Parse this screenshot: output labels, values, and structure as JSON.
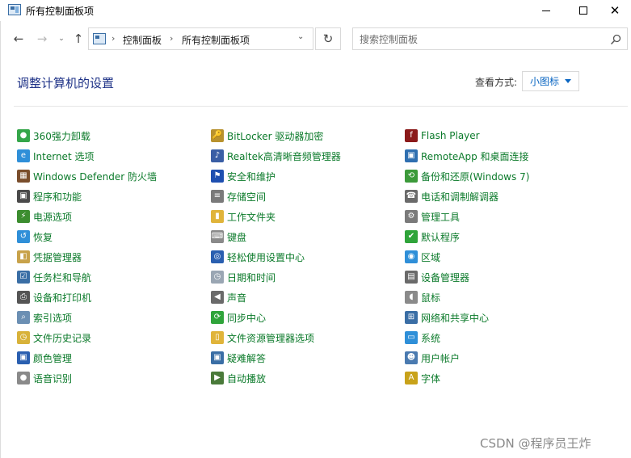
{
  "window": {
    "title": "所有控制面板项",
    "minimize_icon": "minimize-icon",
    "maximize_icon": "maximize-icon",
    "close_icon": "close-icon",
    "close_glyph": "✕"
  },
  "nav": {
    "back_glyph": "←",
    "forward_glyph": "→",
    "recent_glyph": "⌄",
    "up_glyph": "↑",
    "refresh_glyph": "↻",
    "breadcrumb": [
      "控制面板",
      "所有控制面板项"
    ],
    "breadcrumb_sep": "›",
    "dropdown_glyph": "⌄"
  },
  "search": {
    "placeholder": "搜索控制面板"
  },
  "main": {
    "heading": "调整计算机的设置",
    "view_by_label": "查看方式:",
    "view_by_value": "小图标"
  },
  "colors": {
    "link": "#0b7a2a",
    "heading": "#1e3287",
    "accent": "#0a66c2"
  },
  "items": {
    "col1": [
      {
        "label": "360强力卸载",
        "icon": "uninstall-icon",
        "color": "#35a64a",
        "glyph": "●"
      },
      {
        "label": "Internet 选项",
        "icon": "internet-options-icon",
        "color": "#2f8fd8",
        "glyph": "e"
      },
      {
        "label": "Windows Defender 防火墙",
        "icon": "firewall-icon",
        "color": "#7a4e2c",
        "glyph": "▦"
      },
      {
        "label": "程序和功能",
        "icon": "programs-icon",
        "color": "#4a4a4a",
        "glyph": "▣"
      },
      {
        "label": "电源选项",
        "icon": "power-options-icon",
        "color": "#3c8d2f",
        "glyph": "⚡"
      },
      {
        "label": "恢复",
        "icon": "recovery-icon",
        "color": "#2f8fd8",
        "glyph": "↺"
      },
      {
        "label": "凭据管理器",
        "icon": "credential-manager-icon",
        "color": "#c8a24a",
        "glyph": "◧"
      },
      {
        "label": "任务栏和导航",
        "icon": "taskbar-icon",
        "color": "#3a6ea5",
        "glyph": "☑"
      },
      {
        "label": "设备和打印机",
        "icon": "devices-printers-icon",
        "color": "#555555",
        "glyph": "⎙"
      },
      {
        "label": "索引选项",
        "icon": "indexing-icon",
        "color": "#6b8fb3",
        "glyph": "⌕"
      },
      {
        "label": "文件历史记录",
        "icon": "file-history-icon",
        "color": "#d8b23a",
        "glyph": "◷"
      },
      {
        "label": "颜色管理",
        "icon": "color-management-icon",
        "color": "#2a5fb0",
        "glyph": "▣"
      },
      {
        "label": "语音识别",
        "icon": "speech-recognition-icon",
        "color": "#8a8a8a",
        "glyph": "●"
      }
    ],
    "col2": [
      {
        "label": "BitLocker 驱动器加密",
        "icon": "bitlocker-icon",
        "color": "#b8922e",
        "glyph": "🔑"
      },
      {
        "label": "Realtek高清晰音频管理器",
        "icon": "audio-manager-icon",
        "color": "#3a5ea5",
        "glyph": "♪"
      },
      {
        "label": "安全和维护",
        "icon": "security-maintenance-icon",
        "color": "#1e4fb0",
        "glyph": "⚑"
      },
      {
        "label": "存储空间",
        "icon": "storage-spaces-icon",
        "color": "#7a7a7a",
        "glyph": "≡"
      },
      {
        "label": "工作文件夹",
        "icon": "work-folders-icon",
        "color": "#e0b43a",
        "glyph": "▮"
      },
      {
        "label": "键盘",
        "icon": "keyboard-icon",
        "color": "#8a8a8a",
        "glyph": "⌨"
      },
      {
        "label": "轻松使用设置中心",
        "icon": "ease-of-access-icon",
        "color": "#2a5fb0",
        "glyph": "◎"
      },
      {
        "label": "日期和时间",
        "icon": "date-time-icon",
        "color": "#9aa6b3",
        "glyph": "◷"
      },
      {
        "label": "声音",
        "icon": "sound-icon",
        "color": "#6a6a6a",
        "glyph": "◀"
      },
      {
        "label": "同步中心",
        "icon": "sync-center-icon",
        "color": "#2fa43a",
        "glyph": "⟳"
      },
      {
        "label": "文件资源管理器选项",
        "icon": "explorer-options-icon",
        "color": "#e0b43a",
        "glyph": "▯"
      },
      {
        "label": "疑难解答",
        "icon": "troubleshooting-icon",
        "color": "#3a6ea5",
        "glyph": "▣"
      },
      {
        "label": "自动播放",
        "icon": "autoplay-icon",
        "color": "#4a7a3a",
        "glyph": "▶"
      }
    ],
    "col3": [
      {
        "label": "Flash Player",
        "icon": "flash-player-icon",
        "color": "#8b1a1a",
        "glyph": "f"
      },
      {
        "label": "RemoteApp 和桌面连接",
        "icon": "remoteapp-icon",
        "color": "#2f6fb0",
        "glyph": "▣"
      },
      {
        "label": "备份和还原(Windows 7)",
        "icon": "backup-restore-icon",
        "color": "#3c9a3a",
        "glyph": "⟲"
      },
      {
        "label": "电话和调制解调器",
        "icon": "phone-modem-icon",
        "color": "#6a6a6a",
        "glyph": "☎"
      },
      {
        "label": "管理工具",
        "icon": "admin-tools-icon",
        "color": "#7a7a7a",
        "glyph": "⚙"
      },
      {
        "label": "默认程序",
        "icon": "default-programs-icon",
        "color": "#2fa43a",
        "glyph": "✔"
      },
      {
        "label": "区域",
        "icon": "region-icon",
        "color": "#2f8fd8",
        "glyph": "◉"
      },
      {
        "label": "设备管理器",
        "icon": "device-manager-icon",
        "color": "#6a6a6a",
        "glyph": "▤"
      },
      {
        "label": "鼠标",
        "icon": "mouse-icon",
        "color": "#8a8a8a",
        "glyph": "◖"
      },
      {
        "label": "网络和共享中心",
        "icon": "network-sharing-icon",
        "color": "#3a6ea5",
        "glyph": "⊞"
      },
      {
        "label": "系统",
        "icon": "system-icon",
        "color": "#2f8fd8",
        "glyph": "▭"
      },
      {
        "label": "用户帐户",
        "icon": "user-accounts-icon",
        "color": "#4a7ab0",
        "glyph": "☻"
      },
      {
        "label": "字体",
        "icon": "fonts-icon",
        "color": "#c8a21a",
        "glyph": "A"
      }
    ]
  },
  "watermark": "CSDN @程序员王炸"
}
